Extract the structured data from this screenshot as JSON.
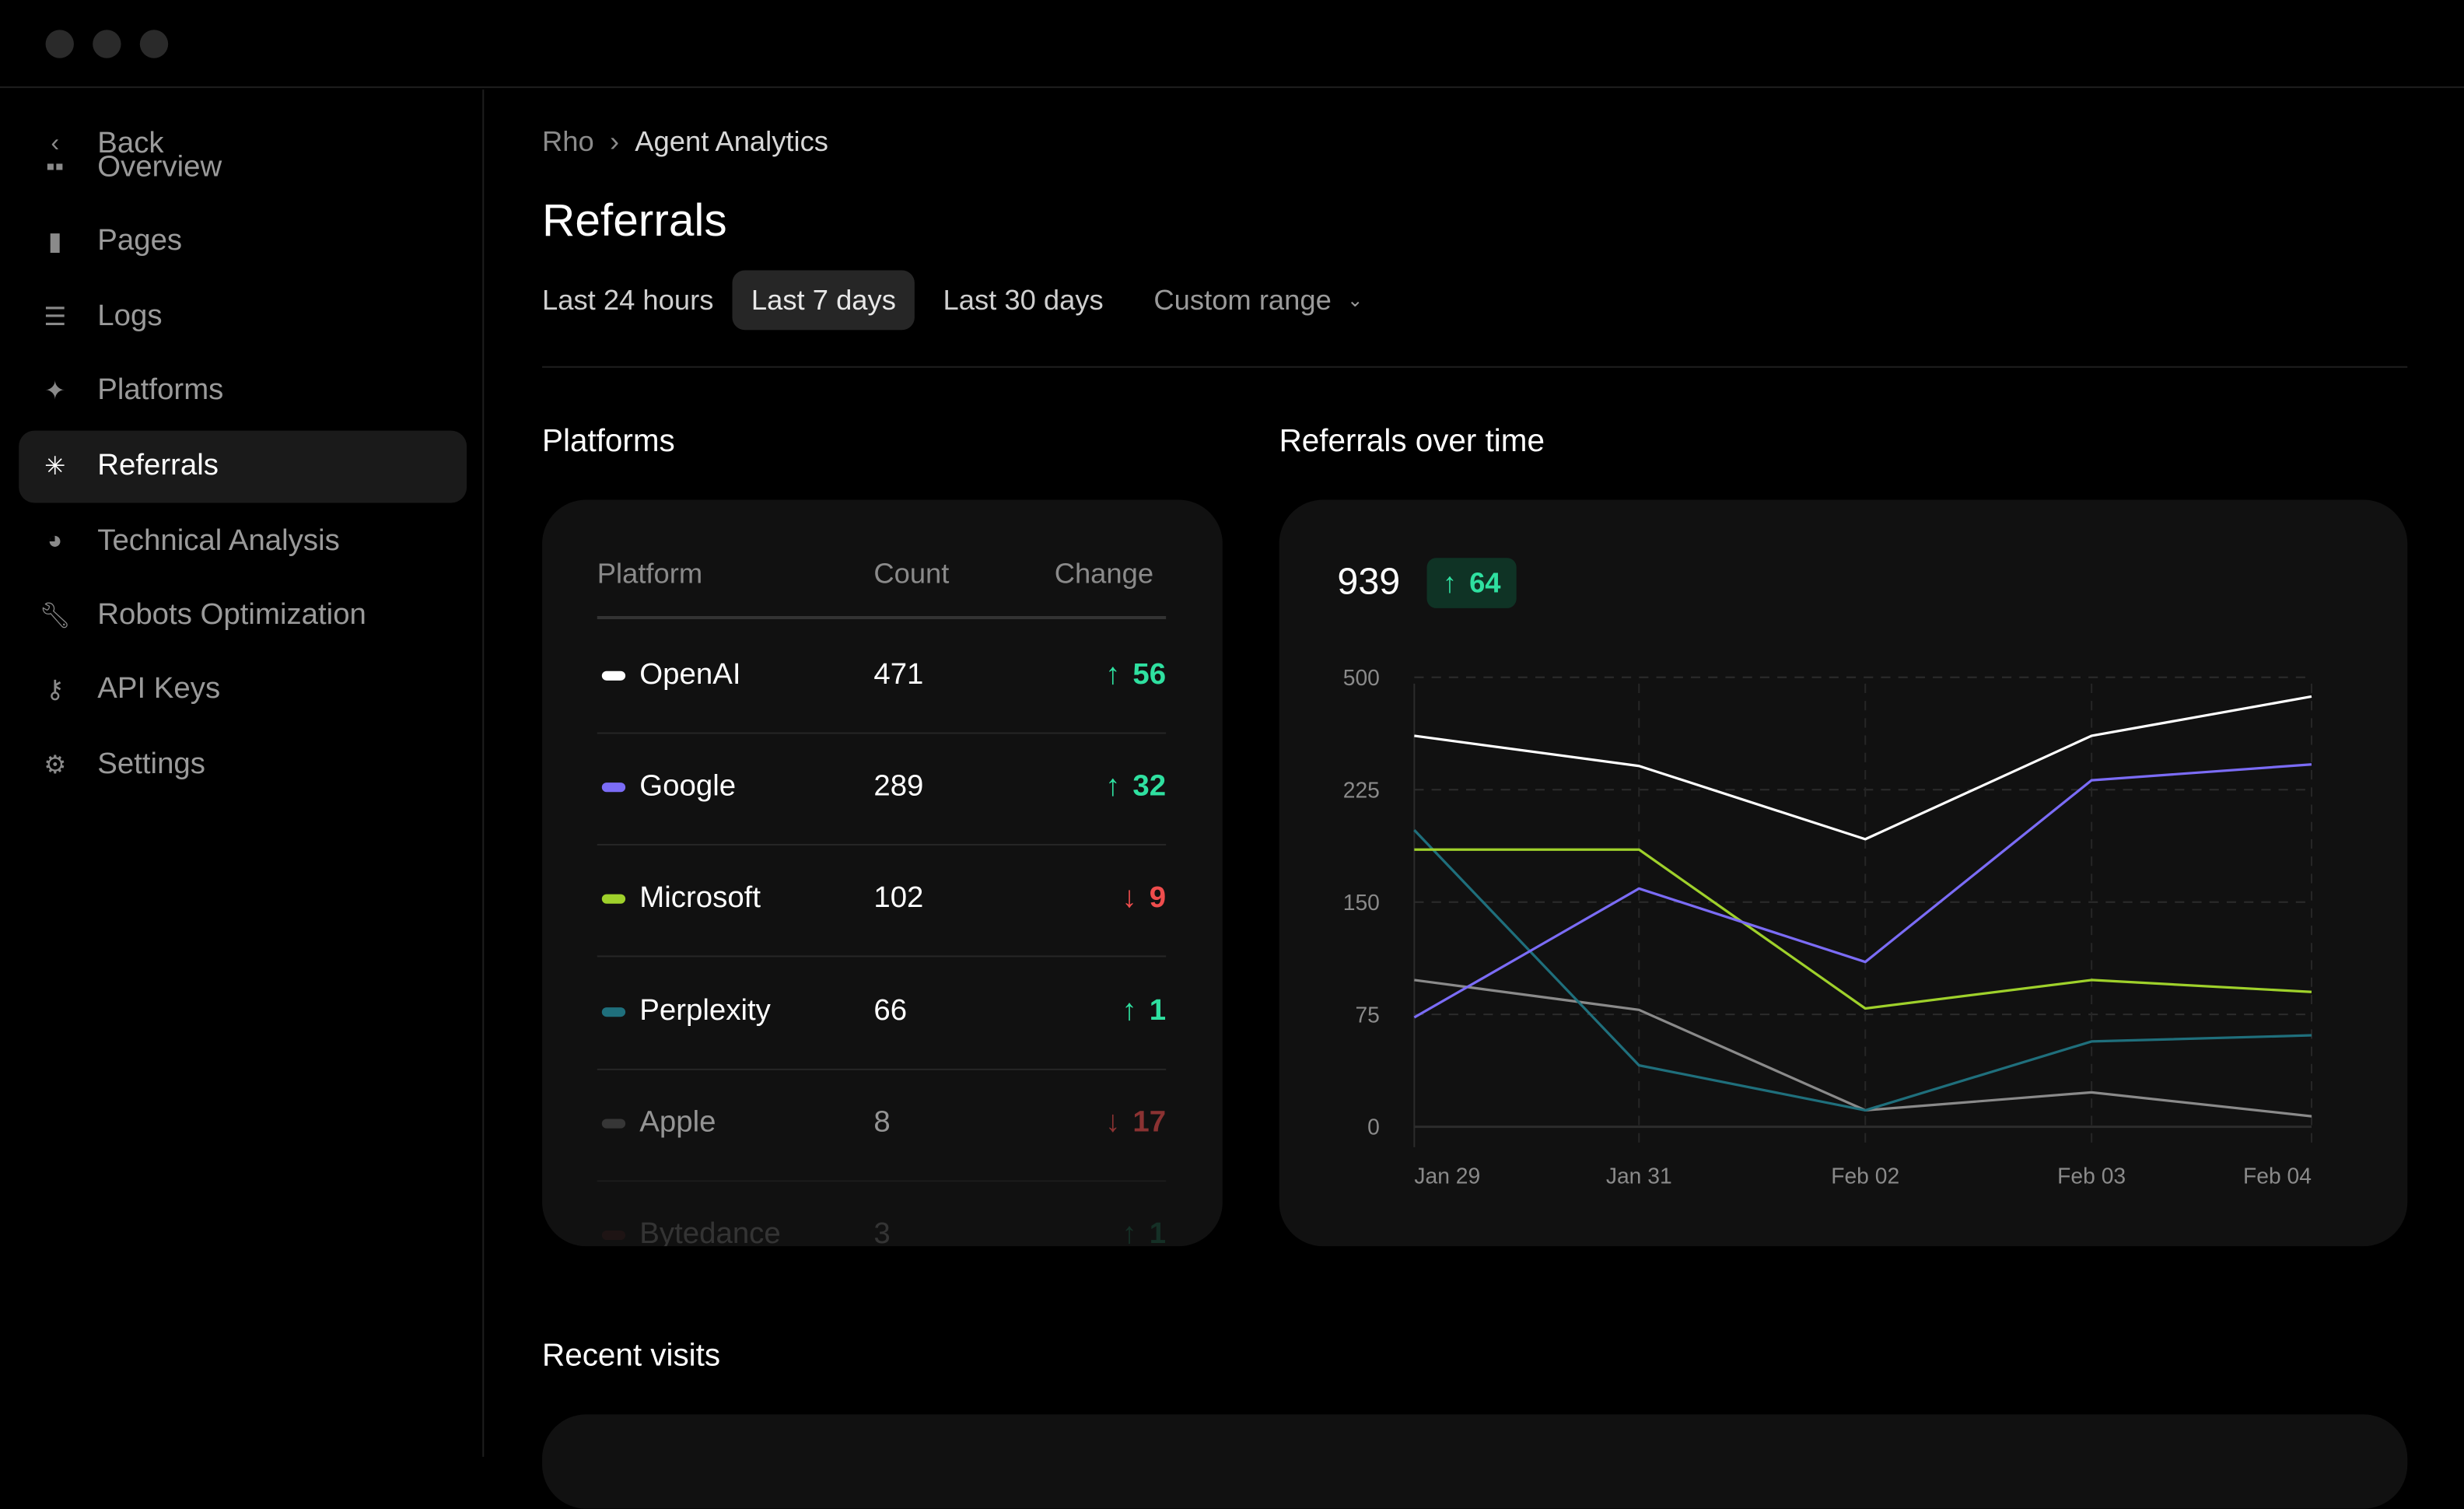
{
  "sidebar": {
    "back": "Back",
    "items": [
      {
        "label": "Overview",
        "icon": "grid-icon"
      },
      {
        "label": "Pages",
        "icon": "file-icon"
      },
      {
        "label": "Logs",
        "icon": "list-icon"
      },
      {
        "label": "Platforms",
        "icon": "sparkles-icon"
      },
      {
        "label": "Referrals",
        "icon": "cursor-click-icon",
        "active": true
      },
      {
        "label": "Technical Analysis",
        "icon": "pie-chart-icon"
      },
      {
        "label": "Robots Optimization",
        "icon": "wrench-icon"
      },
      {
        "label": "API Keys",
        "icon": "key-icon"
      },
      {
        "label": "Settings",
        "icon": "gear-icon"
      }
    ]
  },
  "breadcrumb": [
    "Rho",
    "Agent Analytics"
  ],
  "title": "Referrals",
  "tabs": [
    {
      "label": "Last 24 hours"
    },
    {
      "label": "Last 7 days",
      "active": true
    },
    {
      "label": "Last 30 days"
    },
    {
      "label": "Custom range"
    }
  ],
  "platforms": {
    "title": "Platforms",
    "headers": [
      "Platform",
      "Count",
      "Change"
    ],
    "rows": [
      {
        "name": "OpenAI",
        "count": "471",
        "change": "56",
        "dir": "up",
        "color": "#ffffff"
      },
      {
        "name": "Google",
        "count": "289",
        "change": "32",
        "dir": "up",
        "color": "#7b6cf6"
      },
      {
        "name": "Microsoft",
        "count": "102",
        "change": "9",
        "dir": "down",
        "color": "#9fd12b"
      },
      {
        "name": "Perplexity",
        "count": "66",
        "change": "1",
        "dir": "up",
        "color": "#1f6f7c"
      },
      {
        "name": "Apple",
        "count": "8",
        "change": "17",
        "dir": "down",
        "color": "#555555"
      },
      {
        "name": "Bytedance",
        "count": "3",
        "change": "1",
        "dir": "up",
        "color": "#6a2a2a"
      }
    ]
  },
  "chart_title": "Referrals over time",
  "chart_data": {
    "type": "line",
    "total": "939",
    "delta": "64",
    "delta_dir": "up",
    "categories": [
      "Jan 29",
      "Jan 31",
      "Feb 02",
      "Feb 03",
      "Feb 04"
    ],
    "yticks": [
      0,
      75,
      150,
      225,
      500
    ],
    "ylim": [
      0,
      500
    ],
    "grid": true,
    "series": [
      {
        "color": "#ffffff",
        "values": [
          357,
          283,
          192,
          357,
          453
        ]
      },
      {
        "color": "#7b6cf6",
        "values": [
          73,
          159,
          110,
          248,
          287
        ]
      },
      {
        "color": "#9fd12b",
        "values": [
          185,
          185,
          79,
          98,
          90
        ]
      },
      {
        "color": "#1f6f7c",
        "values": [
          198,
          41,
          11,
          57,
          61
        ]
      },
      {
        "color": "#8a8a8a",
        "values": [
          98,
          78,
          11,
          23,
          7
        ]
      }
    ]
  },
  "recent_title": "Recent visits"
}
